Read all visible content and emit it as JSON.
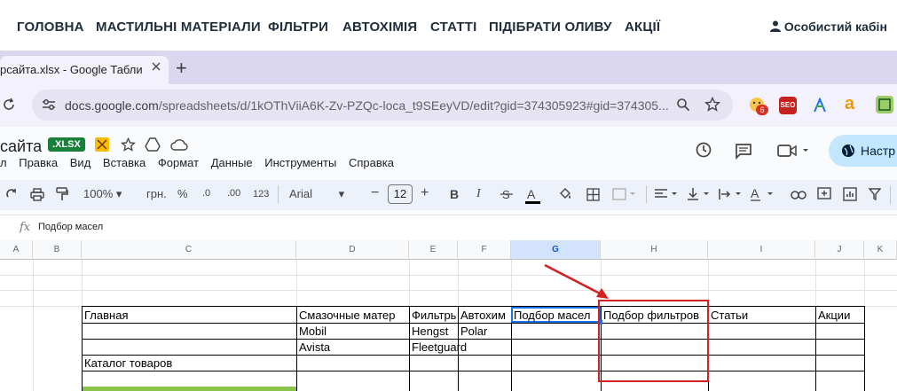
{
  "site_nav": {
    "items": [
      "ГОЛОВНА",
      "МАСТИЛЬНІ МАТЕРІАЛИ",
      "ФІЛЬТРИ",
      "АВТОХІМІЯ",
      "СТАТТІ",
      "ПІДІБРАТИ ОЛИВУ",
      "АКЦІЇ"
    ],
    "account": "Особистий кабін"
  },
  "browser": {
    "tab_title": "рсайта.xlsx - Google Таблиці",
    "new_tab": "+",
    "url_host": "docs.google.com",
    "url_path": "/spreadsheets/d/1kOThViiA6K-Zv-PZQc-loca_t9SEeyVD/edit?gid=374305923#gid=374305...",
    "ext_badge": "6"
  },
  "sheets": {
    "doc_title": "сайта",
    "file_badge": ".XLSX",
    "menu": [
      "л",
      "Правка",
      "Вид",
      "Вставка",
      "Формат",
      "Данные",
      "Инструменты",
      "Справка"
    ],
    "share_label": "Настр",
    "toolbar": {
      "zoom": "100%",
      "currency": "грн.",
      "percent": "%",
      "dec_minus": ".0",
      "dec_plus": ".00",
      "num_format": "123",
      "font": "Arial",
      "font_size": "12",
      "bold": "B",
      "italic": "I",
      "underline": "A"
    },
    "formula_bar": {
      "fx": "fx",
      "value": "Подбор масел"
    },
    "columns": [
      "A",
      "B",
      "C",
      "D",
      "E",
      "F",
      "G",
      "H",
      "I",
      "J",
      "K"
    ],
    "selected_column": "G",
    "rows": [
      {
        "C": "Главная",
        "D": "Смазочные матер",
        "E": "Фильтры",
        "F": "Автохим",
        "G": "Подбор масел",
        "H": "Подбор фильтров",
        "I": "Статьи",
        "J": "Акции"
      },
      {
        "D": "Mobil",
        "E": "Hengst",
        "F": "Polar"
      },
      {
        "D": "Avista",
        "E": "Fleetguard"
      },
      {
        "C": "Каталог товаров"
      }
    ]
  },
  "annotation": {
    "color": "#d32020"
  }
}
